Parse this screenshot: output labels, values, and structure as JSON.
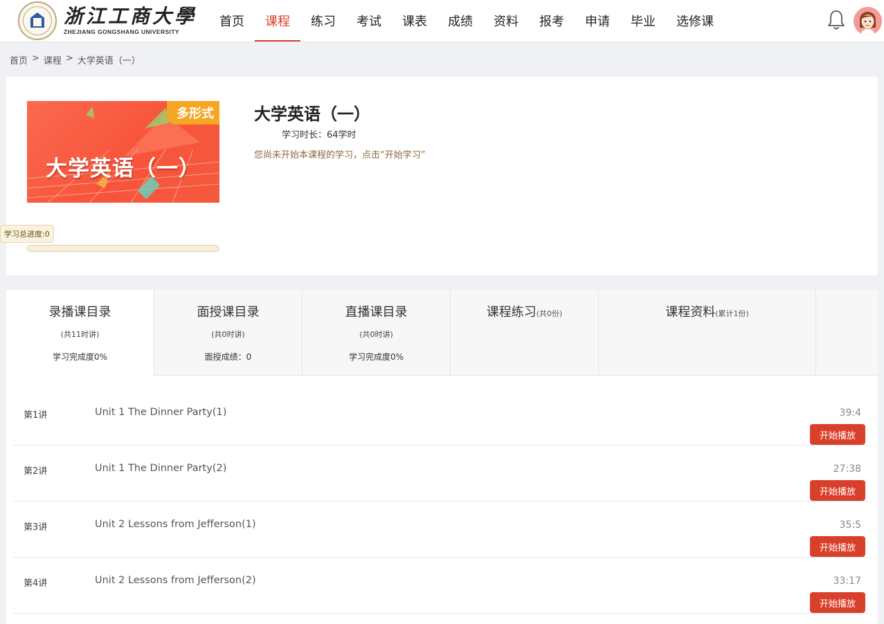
{
  "header": {
    "logo_cn": "浙江工商大學",
    "logo_en": "ZHEJIANG GONGSHANG UNIVERSITY",
    "nav": [
      "首页",
      "课程",
      "练习",
      "考试",
      "课表",
      "成绩",
      "资料",
      "报考",
      "申请",
      "毕业",
      "选修课"
    ],
    "active_nav": "课程",
    "accent_color": "#d9402b"
  },
  "breadcrumb": [
    "首页",
    ">",
    "课程",
    ">",
    "大学英语（一）"
  ],
  "course": {
    "cover_tag": "多形式",
    "cover_title": "大学英语（一）",
    "title": "大学英语（一）",
    "duration": "学习时长：64学时",
    "hint": "您尚未开始本课程的学习，点击“开始学习”",
    "progress_label": "学习总进度:0",
    "progress_value": 0
  },
  "tabs": [
    {
      "title": "录播课目录",
      "small": "",
      "sub": "(共11时讲)",
      "meta": "学习完成度0%"
    },
    {
      "title": "面授课目录",
      "small": "",
      "sub": "(共0时讲)",
      "meta": "面授成绩：0"
    },
    {
      "title": "直播课目录",
      "small": "",
      "sub": "(共0时讲)",
      "meta": "学习完成度0%"
    },
    {
      "title": "课程练习",
      "small": "(共0份)",
      "sub": "",
      "meta": ""
    },
    {
      "title": "课程资料",
      "small": "(累计1份)",
      "sub": "",
      "meta": ""
    }
  ],
  "lectures": [
    {
      "no": "第1讲",
      "title": "Unit 1 The Dinner Party(1)",
      "time": "39:4",
      "button": "开始播放"
    },
    {
      "no": "第2讲",
      "title": "Unit 1 The Dinner Party(2)",
      "time": "27:38",
      "button": "开始播放"
    },
    {
      "no": "第3讲",
      "title": "Unit 2 Lessons from Jefferson(1)",
      "time": "35:5",
      "button": "开始播放"
    },
    {
      "no": "第4讲",
      "title": "Unit 2 Lessons from Jefferson(2)",
      "time": "33:17",
      "button": "开始播放"
    }
  ]
}
